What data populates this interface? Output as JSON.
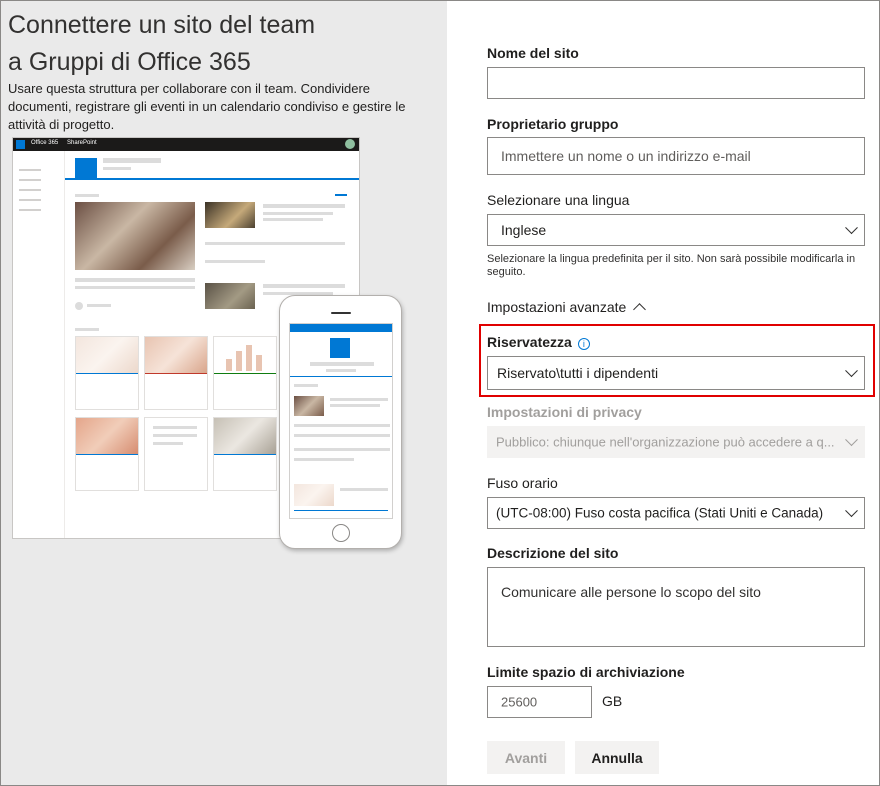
{
  "left": {
    "title_line1": "Connettere un sito del team",
    "title_line2": "a Gruppi di Office 365",
    "description": "Usare questa struttura per collaborare con il team. Condividere documenti, registrare gli eventi in un calendario condiviso e gestire le attività di progetto.",
    "preview": {
      "app_label": "Office 365",
      "product_label": "SharePoint"
    }
  },
  "form": {
    "site_name": {
      "label": "Nome del sito",
      "value": ""
    },
    "group_owner": {
      "label": "Proprietario gruppo",
      "placeholder": "Immettere un nome o un indirizzo e-mail"
    },
    "language": {
      "label": "Selezionare una lingua",
      "value": "Inglese",
      "help": "Selezionare la lingua predefinita per il sito. Non sarà possibile modificarla in seguito."
    },
    "advanced": {
      "label": "Impostazioni avanzate"
    },
    "confidentiality": {
      "label": "Riservatezza",
      "value": "Riservato\\tutti i dipendenti"
    },
    "privacy": {
      "label": "Impostazioni di privacy",
      "value": "Pubblico: chiunque nell'organizzazione può accedere a q..."
    },
    "timezone": {
      "label": "Fuso orario",
      "value": "(UTC-08:00) Fuso costa pacifica (Stati Uniti e Canada)"
    },
    "site_description": {
      "label": "Descrizione del sito",
      "placeholder": "Comunicare alle persone lo scopo del sito"
    },
    "storage": {
      "label": "Limite spazio di archiviazione",
      "value": "25600",
      "unit": "GB"
    },
    "buttons": {
      "next": "Avanti",
      "cancel": "Annulla"
    }
  },
  "colors": {
    "accent": "#0078d4",
    "highlight": "#e00000",
    "left_bg": "#eaeaea"
  }
}
